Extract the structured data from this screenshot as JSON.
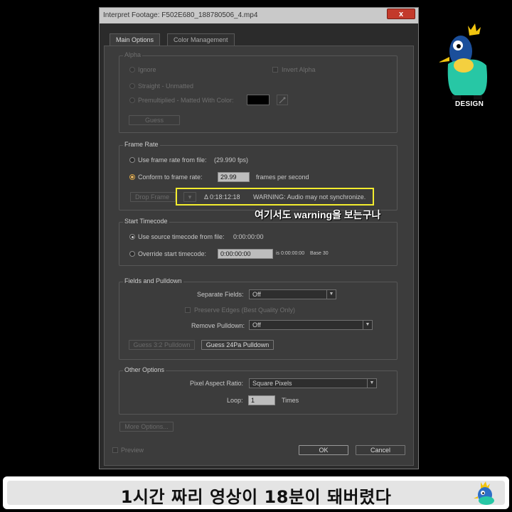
{
  "window": {
    "title": "Interpret Footage: F502E680_188780506_4.mp4",
    "close_label": "x"
  },
  "tabs": [
    {
      "label": "Main Options",
      "active": true
    },
    {
      "label": "Color Management",
      "active": false
    }
  ],
  "alpha": {
    "title": "Alpha",
    "ignore": "Ignore",
    "invert": "Invert Alpha",
    "straight": "Straight - Unmatted",
    "premultiplied": "Premultiplied - Matted With Color:",
    "guess": "Guess",
    "matte_color": "#000000"
  },
  "frame_rate": {
    "title": "Frame Rate",
    "use_file": "Use frame rate from file:",
    "file_fps": "(29.990 fps)",
    "conform": "Conform to frame rate:",
    "conform_value": "29.99",
    "fps_unit": "frames per second",
    "drop_frame": "Drop Frame",
    "delta": "Δ 0:18:12:18",
    "warning": "WARNING: Audio may not synchronize."
  },
  "annotation": "여기서도 warning을 보는구나",
  "start_timecode": {
    "title": "Start Timecode",
    "use_source": "Use source timecode from file:",
    "source_value": "0:00:00:00",
    "override": "Override start timecode:",
    "override_value": "0:00:00:00",
    "is_value": "is 0:00:00:00",
    "base": "Base 30"
  },
  "fields": {
    "title": "Fields and Pulldown",
    "separate_label": "Separate Fields:",
    "separate_value": "Off",
    "preserve": "Preserve Edges (Best Quality Only)",
    "remove_label": "Remove Pulldown:",
    "remove_value": "Off",
    "guess32": "Guess 3:2 Pulldown",
    "guess24": "Guess 24Pa Pulldown"
  },
  "other": {
    "title": "Other Options",
    "par_label": "Pixel Aspect Ratio:",
    "par_value": "Square Pixels",
    "loop_label": "Loop:",
    "loop_value": "1",
    "times": "Times"
  },
  "more_options": "More Options...",
  "preview": "Preview",
  "ok": "OK",
  "cancel": "Cancel",
  "logo_text": "DESIGN",
  "caption": "1시간 짜리 영상이 18분이 돼버렸다",
  "colors": {
    "highlight": "#f3ec2e",
    "bird_teal": "#27c7a5",
    "bird_blue": "#1b4f9b",
    "crown": "#f1c40f"
  }
}
